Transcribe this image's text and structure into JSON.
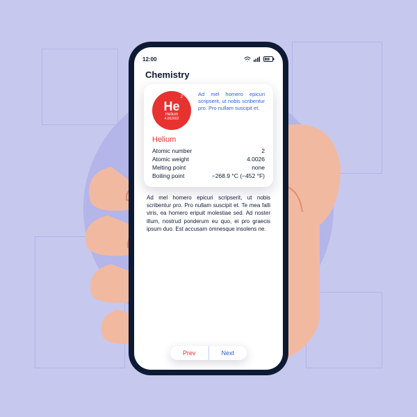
{
  "statusbar": {
    "time": "12:00"
  },
  "page": {
    "title": "Chemistry"
  },
  "element": {
    "atomic_number_badge": "2",
    "symbol": "He",
    "name_small": "Helium",
    "weight_small": "4.002602",
    "blurb": "Ad mel homero epicuri scripserit, ut nobis scribentur pro. Pro nullam suscipit et.",
    "name": "Helium",
    "props": [
      {
        "label": "Atomic number",
        "value": "2"
      },
      {
        "label": "Atomic weight",
        "value": "4.0026"
      },
      {
        "label": "Melting point",
        "value": "none"
      },
      {
        "label": "Boiling point",
        "value": "−268.9 °C (−452 °F)"
      }
    ]
  },
  "body_text": "Ad mel homero epicuri scripserit, ut nobis scribentur pro. Pro nullam suscipit et. Te mea falli viris, ea homero eripuit molestiae sed. Ad noster illum, nostrud ponderum eu quo, ei pro graecis ipsum duo. Est accusam omnesque insolens ne.",
  "nav": {
    "prev": "Prev",
    "next": "Next"
  }
}
